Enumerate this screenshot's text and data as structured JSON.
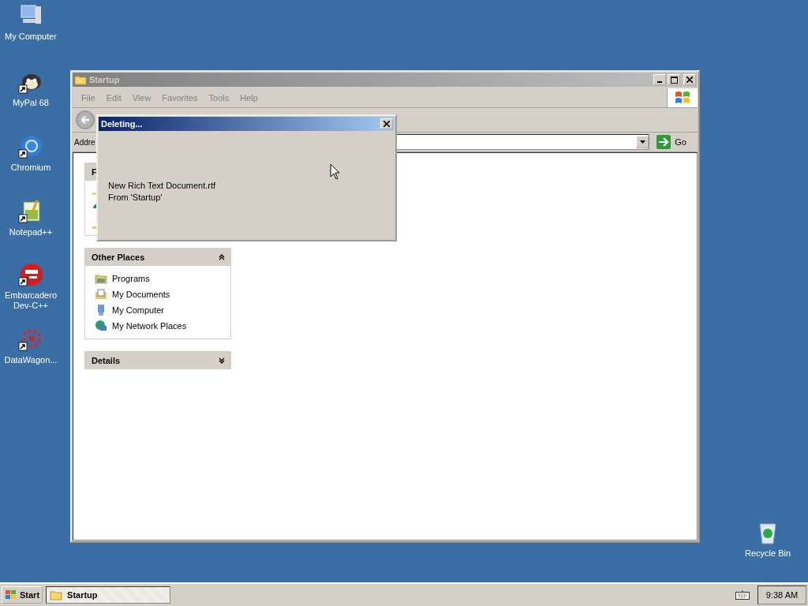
{
  "desktop_icons": [
    {
      "label": "My Computer",
      "shortcut": false
    },
    {
      "label": "MyPal 68",
      "shortcut": true
    },
    {
      "label": "Chromium",
      "shortcut": true
    },
    {
      "label": "Notepad++",
      "shortcut": true
    },
    {
      "label": "Embarcadero Dev-C++",
      "shortcut": true
    },
    {
      "label": "DataWagon...",
      "shortcut": true
    },
    {
      "label": "Recycle Bin",
      "shortcut": false
    }
  ],
  "window": {
    "title": "Startup",
    "active": false,
    "menu": [
      "File",
      "Edit",
      "View",
      "Favorites",
      "Tools",
      "Help"
    ],
    "address": {
      "label": "Addre",
      "go": "Go"
    },
    "panels": [
      {
        "title": "F"
      },
      {
        "title": "Other Places",
        "expanded": true,
        "items": [
          "Programs",
          "My Documents",
          "My Computer",
          "My Network Places"
        ]
      },
      {
        "title": "Details",
        "expanded": false
      }
    ]
  },
  "dialog": {
    "title": "Deleting...",
    "lines": [
      "New Rich Text Document.rtf",
      "From 'Startup'"
    ]
  },
  "taskbar": {
    "start": "Start",
    "tasks": [
      {
        "label": "Startup",
        "selected": true
      }
    ],
    "clock": "9:38 AM"
  }
}
